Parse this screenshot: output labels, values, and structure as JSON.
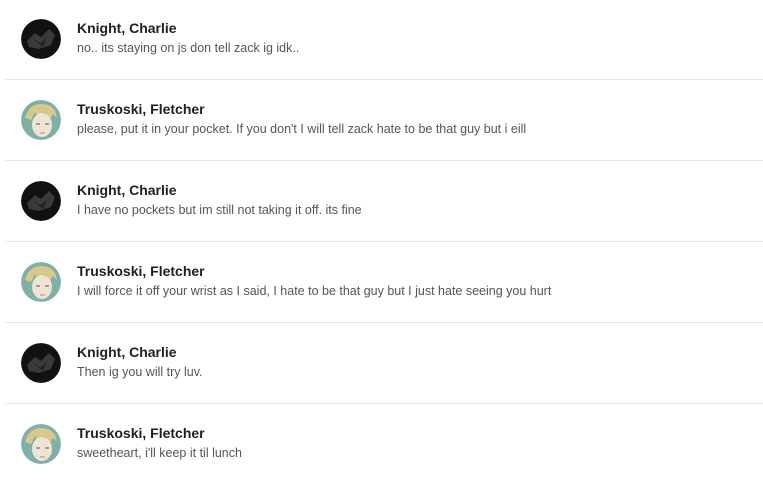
{
  "messages": [
    {
      "author": "Knight, Charlie",
      "text": "no.. its staying on js don tell zack ig idk..",
      "avatar": "charlie-avatar"
    },
    {
      "author": "Truskoski, Fletcher",
      "text": "please, put it in your pocket. If you don't I will tell zack hate to be that guy but i eill",
      "avatar": "fletcher-avatar"
    },
    {
      "author": "Knight, Charlie",
      "text": "I have no pockets but im still not taking it off. its fine",
      "avatar": "charlie-avatar"
    },
    {
      "author": "Truskoski, Fletcher",
      "text": "I will force it off your wrist as I said, I hate to be that guy but I just hate seeing you hurt",
      "avatar": "fletcher-avatar"
    },
    {
      "author": "Knight, Charlie",
      "text": "Then ig you will try luv.",
      "avatar": "charlie-avatar"
    },
    {
      "author": "Truskoski, Fletcher",
      "text": "sweetheart, i'll keep it til lunch",
      "avatar": "fletcher-avatar"
    }
  ],
  "colors": {
    "border": "#e6e6e6",
    "author": "#1f1f1f",
    "text": "#555555"
  }
}
